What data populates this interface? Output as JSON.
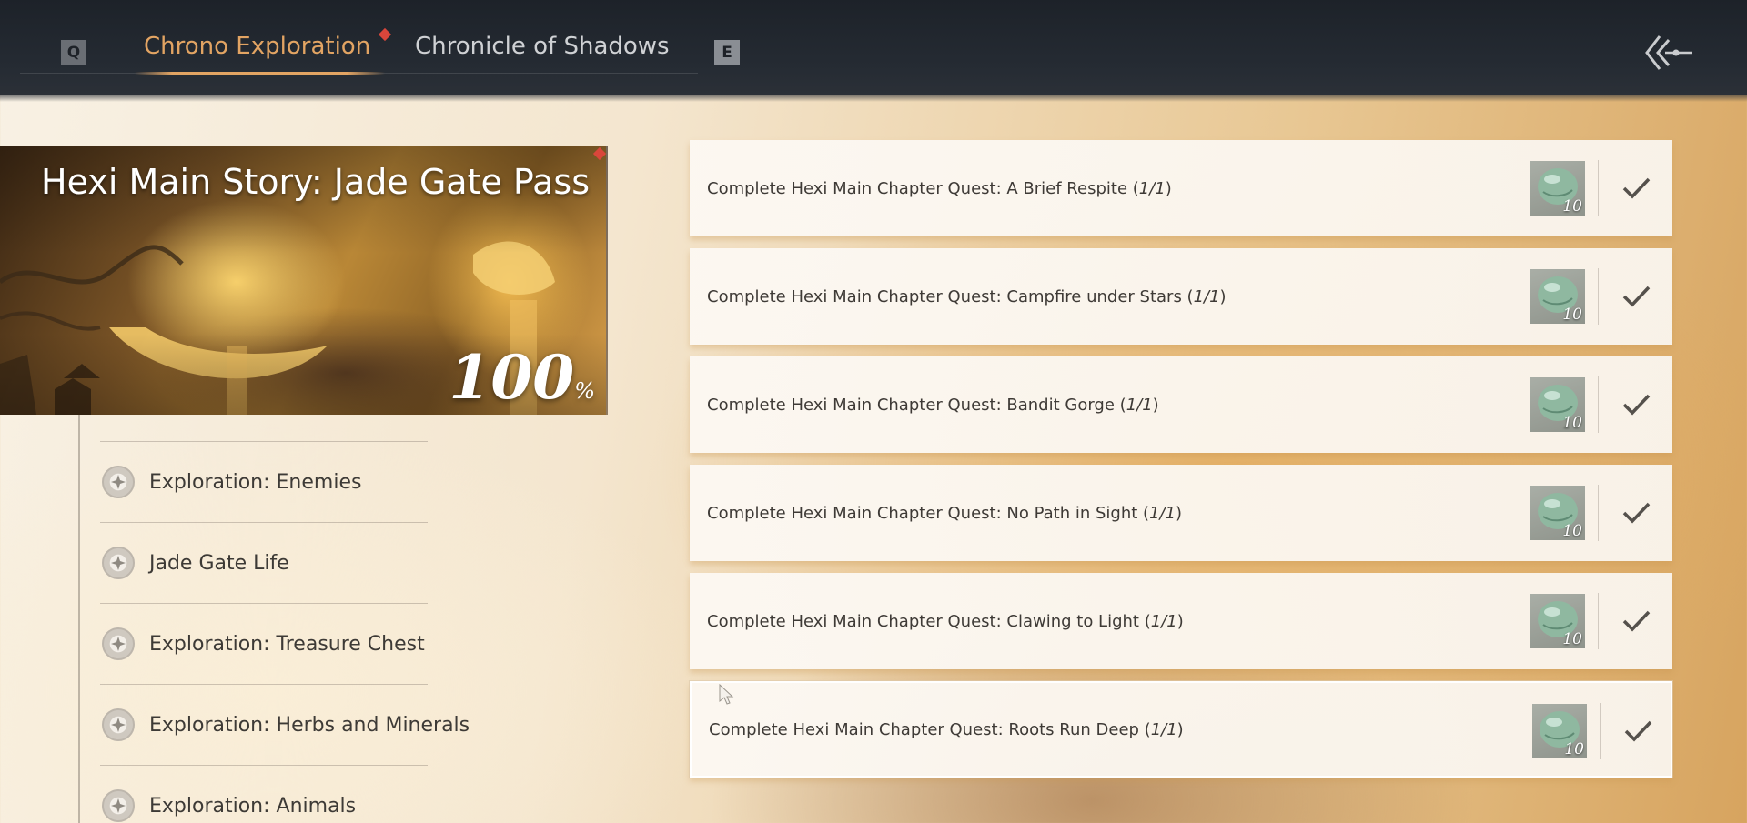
{
  "header": {
    "tabs": [
      {
        "label": "Chrono Exploration",
        "active": true
      },
      {
        "label": "Chronicle of Shadows",
        "active": false
      }
    ],
    "prev_key": "Q",
    "next_key": "E",
    "back_icon": "back-arrow-icon"
  },
  "banner": {
    "title": "Hexi Main Story: Jade Gate Pass",
    "percent": "100",
    "percent_unit": "%"
  },
  "categories": [
    {
      "label": "Exploration: Enemies",
      "icon": "compass-icon"
    },
    {
      "label": "Jade Gate Life",
      "icon": "compass-icon"
    },
    {
      "label": "Exploration: Treasure Chest",
      "icon": "compass-icon"
    },
    {
      "label": "Exploration: Herbs and Minerals",
      "icon": "compass-icon"
    },
    {
      "label": "Exploration: Animals",
      "icon": "compass-icon"
    }
  ],
  "quests": [
    {
      "text": "Complete Hexi Main Chapter Quest: A Brief Respite",
      "progress": "1/1",
      "reward": "10",
      "reward_icon": "jade-token-icon",
      "claimed": true
    },
    {
      "text": "Complete Hexi Main Chapter Quest: Campfire under Stars",
      "progress": "1/1",
      "reward": "10",
      "reward_icon": "jade-token-icon",
      "claimed": true
    },
    {
      "text": "Complete Hexi Main Chapter Quest: Bandit Gorge",
      "progress": "1/1",
      "reward": "10",
      "reward_icon": "jade-token-icon",
      "claimed": true
    },
    {
      "text": "Complete Hexi Main Chapter Quest: No Path in Sight",
      "progress": "1/1",
      "reward": "10",
      "reward_icon": "jade-token-icon",
      "claimed": true
    },
    {
      "text": "Complete Hexi Main Chapter Quest: Clawing to Light",
      "progress": "1/1",
      "reward": "10",
      "reward_icon": "jade-token-icon",
      "claimed": true
    },
    {
      "text": "Complete Hexi Main Chapter Quest: Roots Run Deep",
      "progress": "1/1",
      "reward": "10",
      "reward_icon": "jade-token-icon",
      "claimed": true
    }
  ],
  "colors": {
    "accent": "#e2a463",
    "notification": "#d9463b",
    "topbar": "#222830"
  }
}
